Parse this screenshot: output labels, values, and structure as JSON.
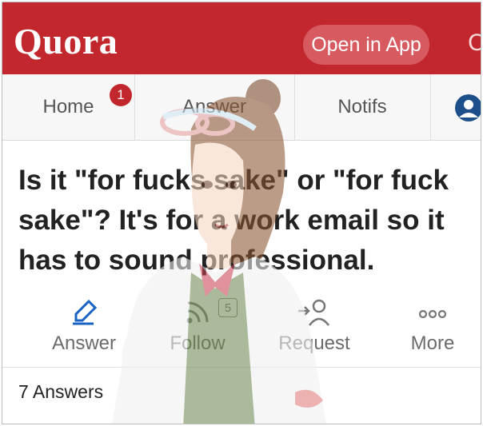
{
  "header": {
    "logo": "Quora",
    "open_app": "Open in App",
    "edge_glyph": "C"
  },
  "nav": {
    "home": "Home",
    "home_badge": "1",
    "answer": "Answer",
    "notifs": "Notifs",
    "profile_icon": "profile-icon"
  },
  "question": {
    "lines": [
      "Is it \"for fucks sake\" or \"for fuck",
      "sake\"? It's for a work email so it",
      "has to sound professional."
    ]
  },
  "actions": {
    "answer": "Answer",
    "follow": "Follow",
    "follow_count": "5",
    "request": "Request",
    "more": "More"
  },
  "footer": {
    "answers_count": "7 Answers"
  },
  "colors": {
    "brand": "#c1272d",
    "button": "#d65a5f",
    "text": "#222222",
    "muted": "#6b6b6b"
  }
}
